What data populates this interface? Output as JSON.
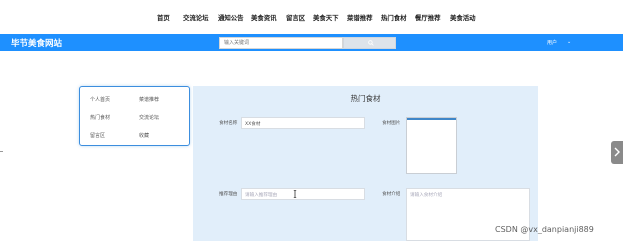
{
  "nav": {
    "items": [
      "首页",
      "交流论坛",
      "通知公告",
      "美食资讯",
      "留言区",
      "美食天下",
      "菜谱推荐",
      "热门食材",
      "餐厅推荐",
      "美食活动"
    ]
  },
  "header": {
    "title": "毕节美食网站",
    "search": {
      "placeholder": "输入关键词",
      "value": ""
    },
    "user_menu": "用户",
    "caret": "⌄",
    "bg_color": "#1e90ff"
  },
  "left_menu": {
    "items": [
      "个人首页",
      "菜谱推荐",
      "热门食材",
      "交流论坛",
      "留言区",
      "收藏"
    ]
  },
  "form": {
    "title": "热门食材",
    "food_name_label": "食材名称",
    "food_name_value": "XX食材",
    "food_image_label": "食材图片",
    "recommend_reason_label": "推荐理由",
    "recommend_reason_placeholder": "请输入推荐理由",
    "intro_label": "食材介绍",
    "intro_placeholder": "请输入食材介绍"
  },
  "icons": {
    "search": "search-icon",
    "text_cursor": "text-cursor-icon",
    "side_tab": "chevron-right-icon"
  },
  "watermark": "CSDN @vx_danpianji889"
}
